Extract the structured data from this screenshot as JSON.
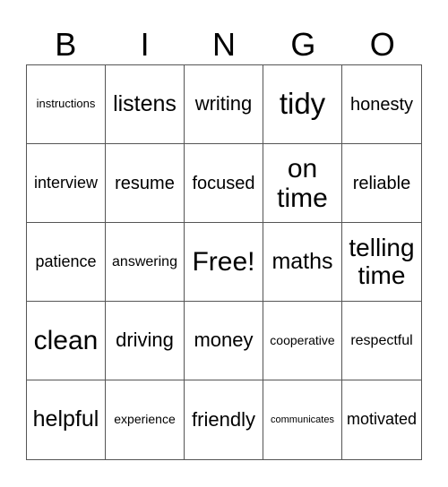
{
  "header": {
    "letters": [
      "B",
      "I",
      "N",
      "G",
      "O"
    ]
  },
  "grid": {
    "cells": [
      "instructions",
      "listens",
      "writing",
      "tidy",
      "honesty",
      "interview",
      "resume",
      "focused",
      "on time",
      "reliable",
      "patience",
      "answering",
      "Free!",
      "maths",
      "telling time",
      "clean",
      "driving",
      "money",
      "cooperative",
      "respectful",
      "helpful",
      "experience",
      "friendly",
      "communicates",
      "motivated"
    ],
    "free_space_index": 12
  }
}
